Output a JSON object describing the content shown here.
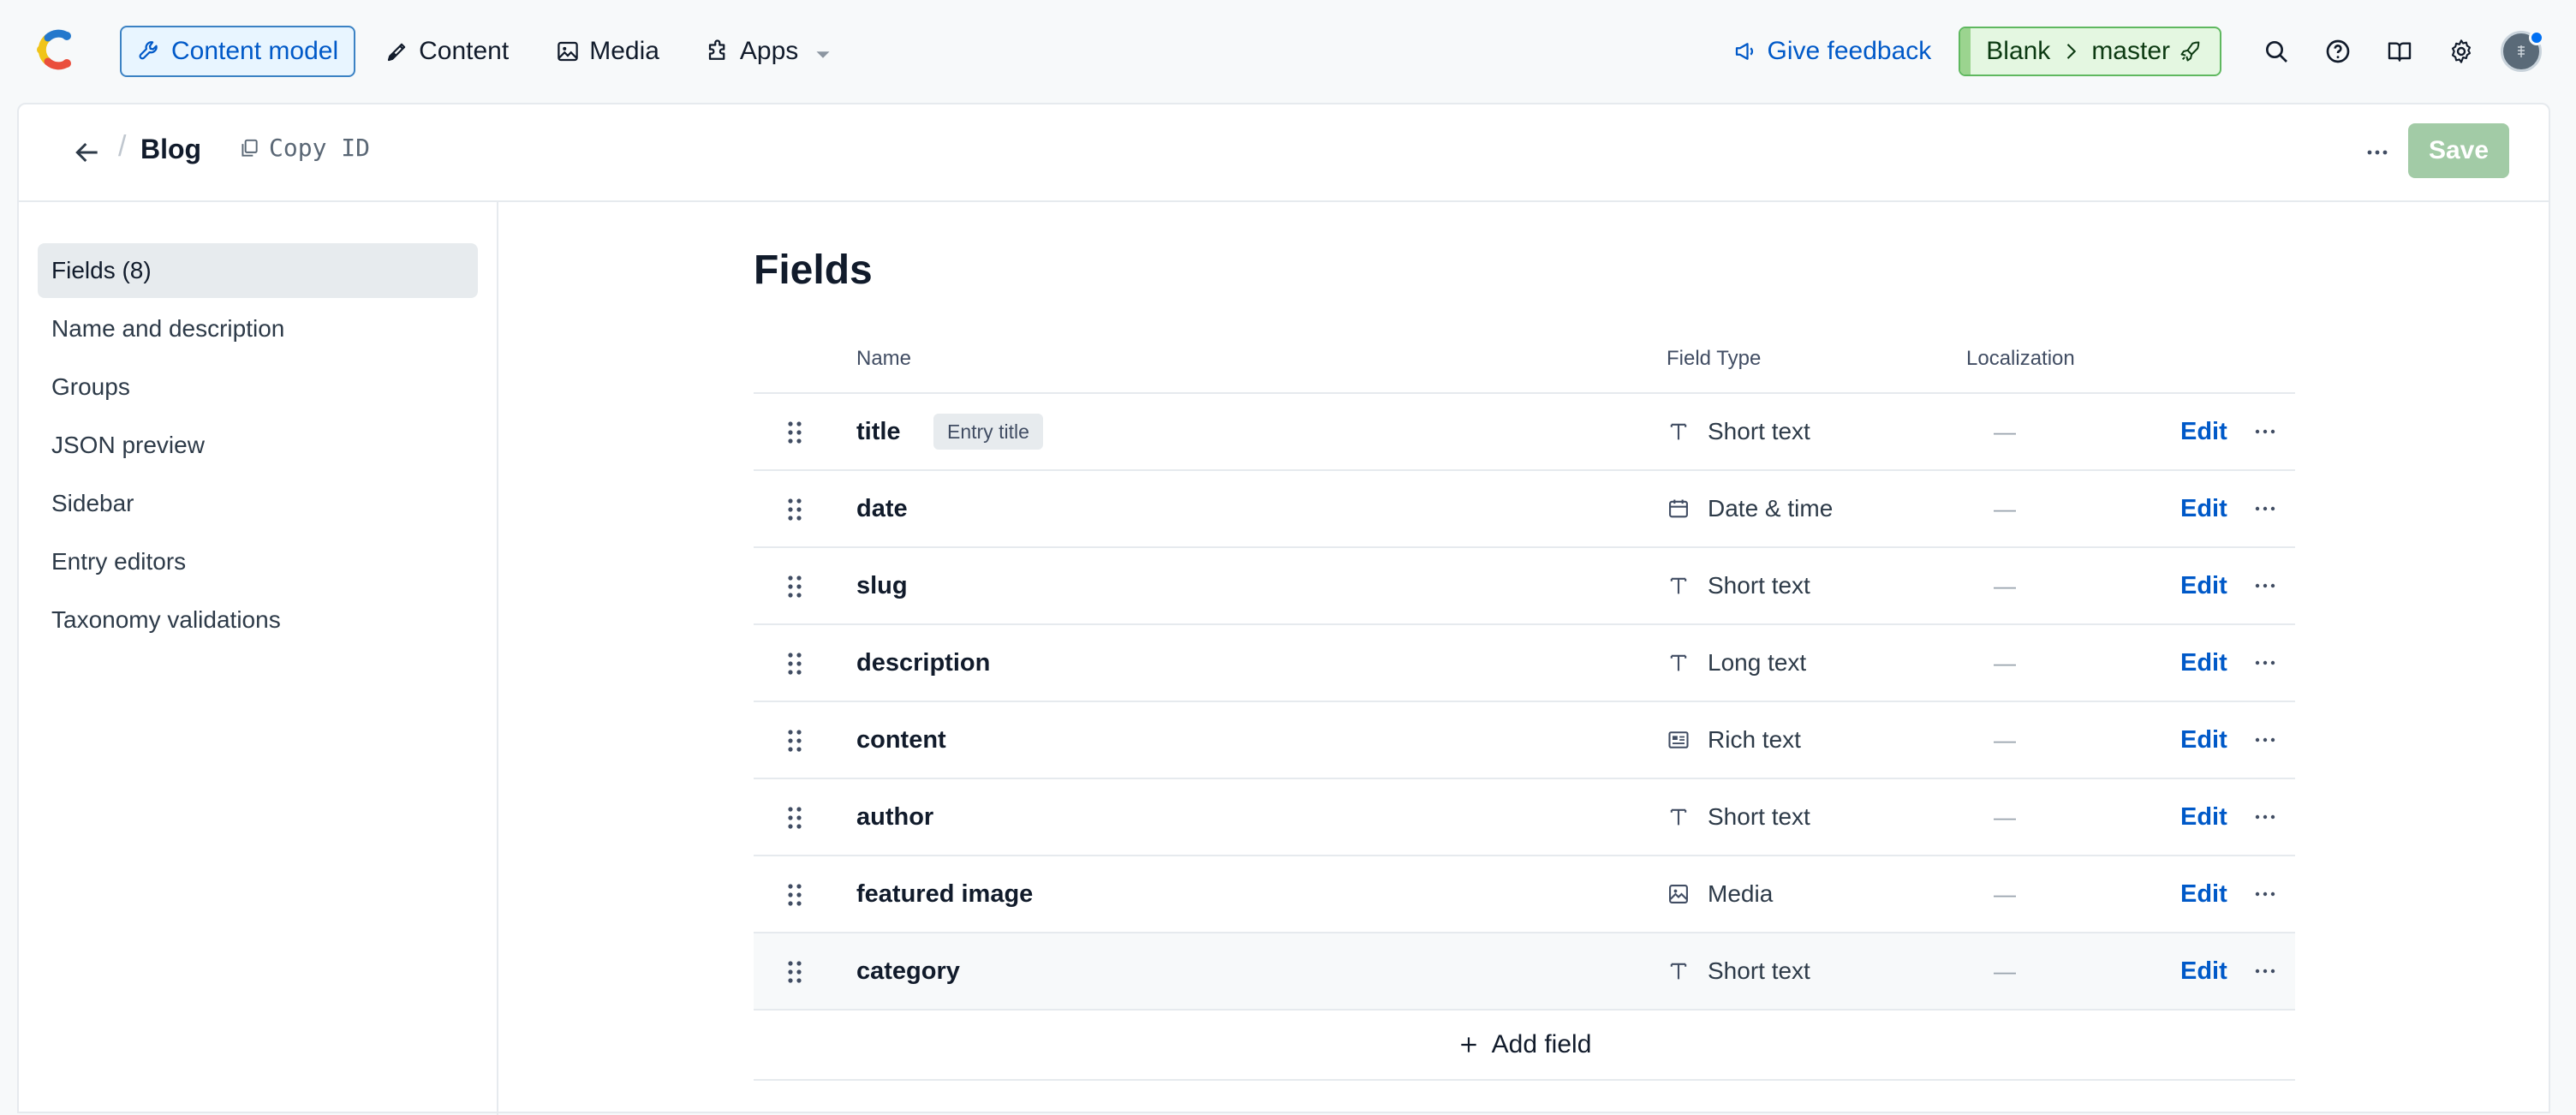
{
  "nav": {
    "items": [
      {
        "label": "Content model",
        "icon": "wrench-icon",
        "active": true
      },
      {
        "label": "Content",
        "icon": "pen-icon",
        "active": false
      },
      {
        "label": "Media",
        "icon": "image-icon",
        "active": false
      },
      {
        "label": "Apps",
        "icon": "puzzle-icon",
        "active": false
      }
    ],
    "feedback_label": "Give feedback",
    "env": {
      "space": "Blank",
      "environment": "master"
    }
  },
  "header": {
    "title": "Blog",
    "copy_id_label": "Copy ID",
    "save_label": "Save"
  },
  "sidebar": {
    "items": [
      {
        "label": "Fields (8)",
        "active": true
      },
      {
        "label": "Name and description"
      },
      {
        "label": "Groups"
      },
      {
        "label": "JSON preview"
      },
      {
        "label": "Sidebar"
      },
      {
        "label": "Entry editors"
      },
      {
        "label": "Taxonomy validations"
      }
    ]
  },
  "main": {
    "title": "Fields",
    "columns": {
      "name": "Name",
      "type": "Field Type",
      "localization": "Localization"
    },
    "rows": [
      {
        "name": "title",
        "tag": "Entry title",
        "type": "Short text",
        "type_icon": "text-icon",
        "localization": "—",
        "edit": "Edit"
      },
      {
        "name": "date",
        "tag": "",
        "type": "Date & time",
        "type_icon": "calendar-icon",
        "localization": "—",
        "edit": "Edit"
      },
      {
        "name": "slug",
        "tag": "",
        "type": "Short text",
        "type_icon": "text-icon",
        "localization": "—",
        "edit": "Edit"
      },
      {
        "name": "description",
        "tag": "",
        "type": "Long text",
        "type_icon": "text-icon",
        "localization": "—",
        "edit": "Edit"
      },
      {
        "name": "content",
        "tag": "",
        "type": "Rich text",
        "type_icon": "rich-text-icon",
        "localization": "—",
        "edit": "Edit"
      },
      {
        "name": "author",
        "tag": "",
        "type": "Short text",
        "type_icon": "text-icon",
        "localization": "—",
        "edit": "Edit"
      },
      {
        "name": "featured image",
        "tag": "",
        "type": "Media",
        "type_icon": "media-icon",
        "localization": "—",
        "edit": "Edit"
      },
      {
        "name": "category",
        "tag": "",
        "type": "Short text",
        "type_icon": "text-icon",
        "localization": "—",
        "edit": "Edit"
      }
    ],
    "add_field_label": "Add field"
  },
  "colors": {
    "accent": "#0059c8",
    "env_green": "#5fb85f",
    "save_disabled": "#a2cba6"
  }
}
